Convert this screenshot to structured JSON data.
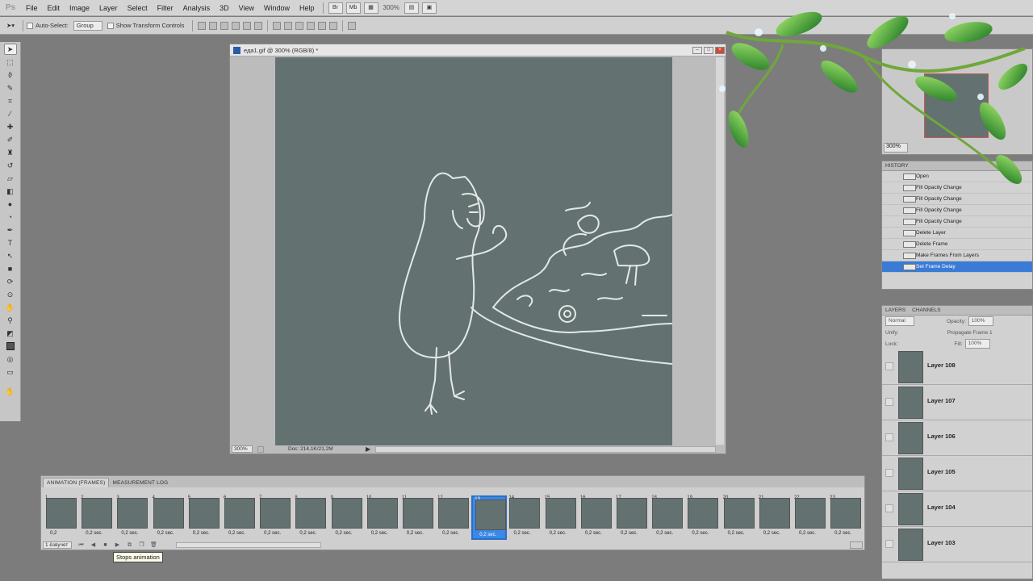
{
  "app": {
    "logo": "Ps",
    "menus": [
      "File",
      "Edit",
      "Image",
      "Layer",
      "Select",
      "Filter",
      "Analysis",
      "3D",
      "View",
      "Window",
      "Help"
    ],
    "zoom_display": "300%"
  },
  "options_bar": {
    "auto_select_label": "Auto-Select:",
    "auto_select_value": "Group",
    "show_transform_label": "Show Transform Controls"
  },
  "document": {
    "title": "еда1.gif @ 300% (RGB/8) *",
    "zoom": "300%",
    "doc_info": "Doc: 214,1K/21,2M"
  },
  "animation_panel": {
    "tabs": [
      "ANIMATION (FRAMES)",
      "MEASUREMENT LOG"
    ],
    "frames": [
      {
        "num": "1",
        "delay": "0,2"
      },
      {
        "num": "2",
        "delay": "0,2 sec."
      },
      {
        "num": "3",
        "delay": "0,2 sec."
      },
      {
        "num": "4",
        "delay": "0,2 sec."
      },
      {
        "num": "5",
        "delay": "0,2 sec."
      },
      {
        "num": "6",
        "delay": "0,2 sec."
      },
      {
        "num": "7",
        "delay": "0,2 sec."
      },
      {
        "num": "8",
        "delay": "0,2 sec."
      },
      {
        "num": "9",
        "delay": "0,2 sec."
      },
      {
        "num": "10",
        "delay": "0,2 sec."
      },
      {
        "num": "11",
        "delay": "0,2 sec."
      },
      {
        "num": "12",
        "delay": "0,2 sec."
      },
      {
        "num": "13",
        "delay": "0,2 sec."
      },
      {
        "num": "14",
        "delay": "0,2 sec."
      },
      {
        "num": "15",
        "delay": "0,2 sec."
      },
      {
        "num": "16",
        "delay": "0,2 sec."
      },
      {
        "num": "17",
        "delay": "0,2 sec."
      },
      {
        "num": "18",
        "delay": "0,2 sec."
      },
      {
        "num": "19",
        "delay": "0,2 sec."
      },
      {
        "num": "20",
        "delay": "0,2 sec."
      },
      {
        "num": "21",
        "delay": "0,2 sec."
      },
      {
        "num": "22",
        "delay": "0,2 sec."
      },
      {
        "num": "23",
        "delay": "0,2 sec."
      }
    ],
    "selected_frame": "13",
    "loop_value": "1 ёзвучет",
    "tooltip": "Stops animation"
  },
  "navigator": {
    "zoom": "300%"
  },
  "history": {
    "title": "HISTORY",
    "items": [
      "Open",
      "Fill Opacity Change",
      "Fill Opacity Change",
      "Fill Opacity Change",
      "Fill Opacity Change",
      "Delete Layer",
      "Delete Frame",
      "Make Frames From Layers",
      "Set Frame Delay"
    ],
    "active_index": 8
  },
  "layers_panel": {
    "tabs": [
      "LAYERS",
      "CHANNELS"
    ],
    "blend_mode": "Normal",
    "opacity_label": "Opacity:",
    "opacity_value": "100%",
    "unify_label": "Unify:",
    "propagate_label": "Propagate Frame 1",
    "lock_label": "Lock:",
    "fill_label": "Fill:",
    "fill_value": "100%",
    "layers": [
      "Layer 108",
      "Layer 107",
      "Layer 106",
      "Layer 105",
      "Layer 104",
      "Layer 103"
    ]
  },
  "colors": {
    "canvas": "#637270",
    "selection": "#3a88e8",
    "workspace": "#7c7c7c"
  }
}
